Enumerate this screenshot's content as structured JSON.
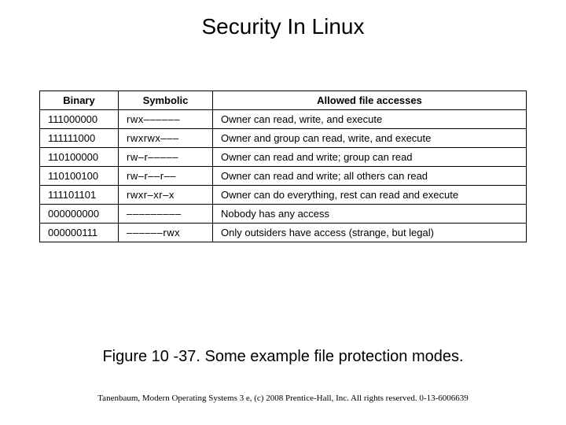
{
  "title": "Security In Linux",
  "table": {
    "headers": {
      "binary": "Binary",
      "symbolic": "Symbolic",
      "access": "Allowed file accesses"
    },
    "rows": [
      {
        "binary": "111000000",
        "symbolic": "rwx––––––",
        "access": "Owner can read, write, and execute"
      },
      {
        "binary": "111111000",
        "symbolic": "rwxrwx–––",
        "access": "Owner and group can read, write, and execute"
      },
      {
        "binary": "110100000",
        "symbolic": "rw–r–––––",
        "access": "Owner can read and write; group can read"
      },
      {
        "binary": "110100100",
        "symbolic": "rw–r––r––",
        "access": "Owner can read and write; all others can read"
      },
      {
        "binary": "111101101",
        "symbolic": "rwxr–xr–x",
        "access": "Owner can do everything, rest can read and execute"
      },
      {
        "binary": "000000000",
        "symbolic": "–––––––––",
        "access": "Nobody has any access"
      },
      {
        "binary": "000000111",
        "symbolic": "––––––rwx",
        "access": "Only outsiders have access (strange, but legal)"
      }
    ]
  },
  "caption": "Figure 10 -37. Some example file protection modes.",
  "footer": "Tanenbaum, Modern Operating Systems 3 e, (c) 2008 Prentice-Hall, Inc. All rights reserved. 0-13-6006639"
}
